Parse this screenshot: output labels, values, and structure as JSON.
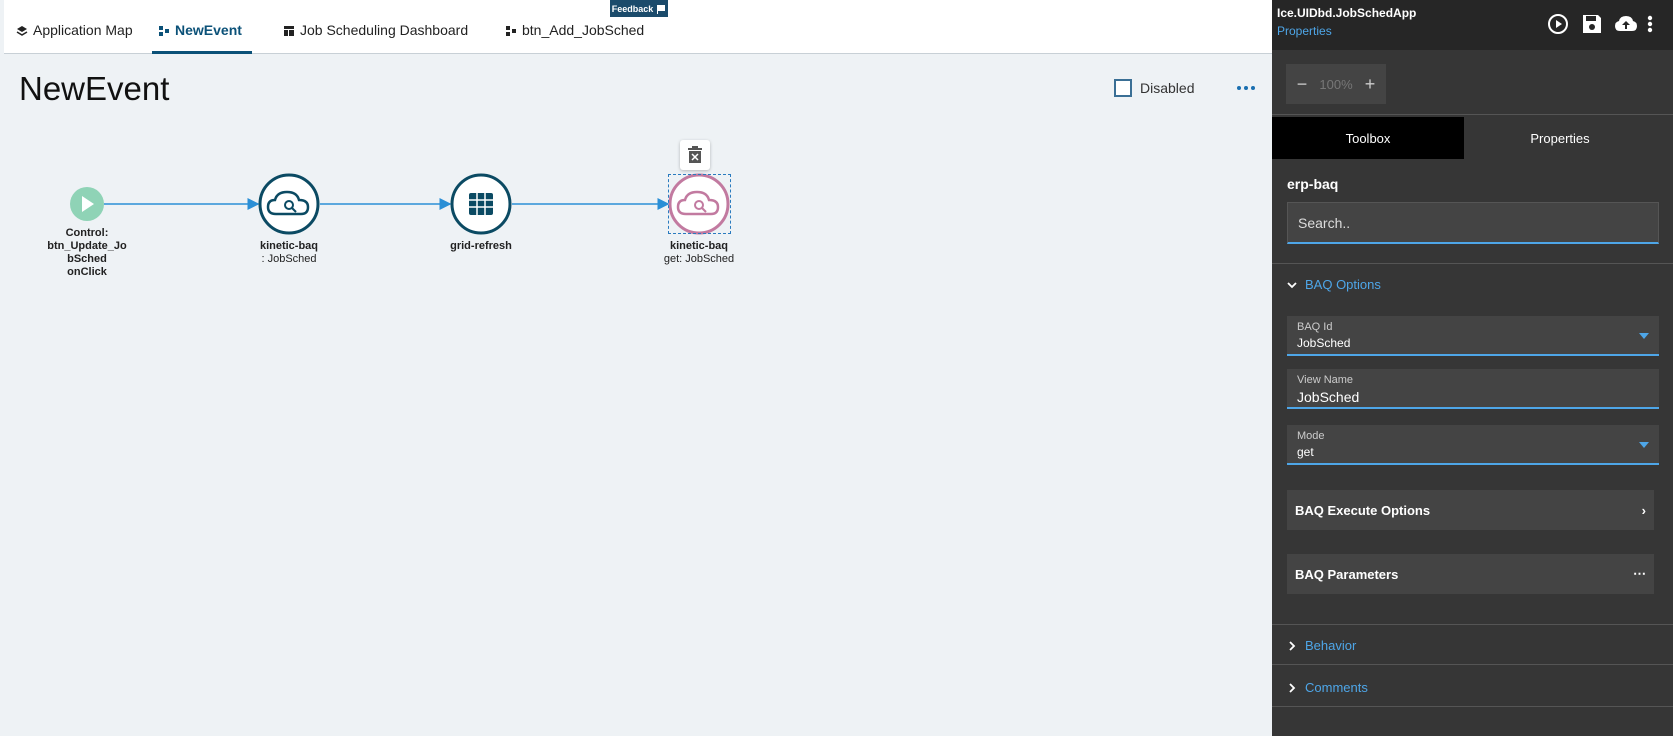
{
  "tabs": [
    {
      "label": "Application Map",
      "icon": "layers-icon",
      "active": false
    },
    {
      "label": "NewEvent",
      "icon": "event-icon",
      "active": true
    },
    {
      "label": "Job Scheduling Dashboard",
      "icon": "dashboard-icon",
      "active": false
    },
    {
      "label": "btn_Add_JobSched",
      "icon": "event-icon",
      "active": false
    }
  ],
  "feedback": {
    "label": "Feedback",
    "icon": "flag-icon"
  },
  "canvas": {
    "title": "NewEvent",
    "disabled_label": "Disabled",
    "disabled_checked": false,
    "nodes": [
      {
        "id": "trigger",
        "label_lines": [
          "Control:",
          "btn_Update_Jo",
          "bSched",
          "onClick"
        ],
        "icon": "play-icon"
      },
      {
        "id": "baq1",
        "label_lines": [
          "kinetic-baq",
          ": JobSched"
        ],
        "icon": "cloud-search-icon"
      },
      {
        "id": "grid",
        "label_lines": [
          "grid-refresh"
        ],
        "icon": "grid-icon"
      },
      {
        "id": "baq2",
        "label_lines": [
          "kinetic-baq",
          "get: JobSched"
        ],
        "icon": "cloud-search-icon",
        "selected": true
      }
    ]
  },
  "panel": {
    "app_name": "Ice.UIDbd.JobSchedApp",
    "properties_link": "Properties",
    "zoom": {
      "value": "100%",
      "minus": "−",
      "plus": "+"
    },
    "tabs": {
      "toolbox": "Toolbox",
      "properties": "Properties"
    },
    "section_title": "erp-baq",
    "search": {
      "placeholder": "Search..",
      "value": ""
    },
    "baq_options": {
      "title": "BAQ Options",
      "baq_id": {
        "label": "BAQ Id",
        "value": "JobSched"
      },
      "view_name": {
        "label": "View Name",
        "value": "JobSched"
      },
      "mode": {
        "label": "Mode",
        "value": "get"
      },
      "execute_options": {
        "label": "BAQ Execute Options",
        "right": "›"
      },
      "parameters": {
        "label": "BAQ Parameters",
        "right": "⋯"
      }
    },
    "behavior": "Behavior",
    "comments": "Comments"
  },
  "colors": {
    "accent": "#4ea6e8",
    "node_dark": "#0b4a63",
    "node_selected": "#c27aa0",
    "trigger": "#8fd3b6",
    "flow_line": "#2a8fd6"
  }
}
